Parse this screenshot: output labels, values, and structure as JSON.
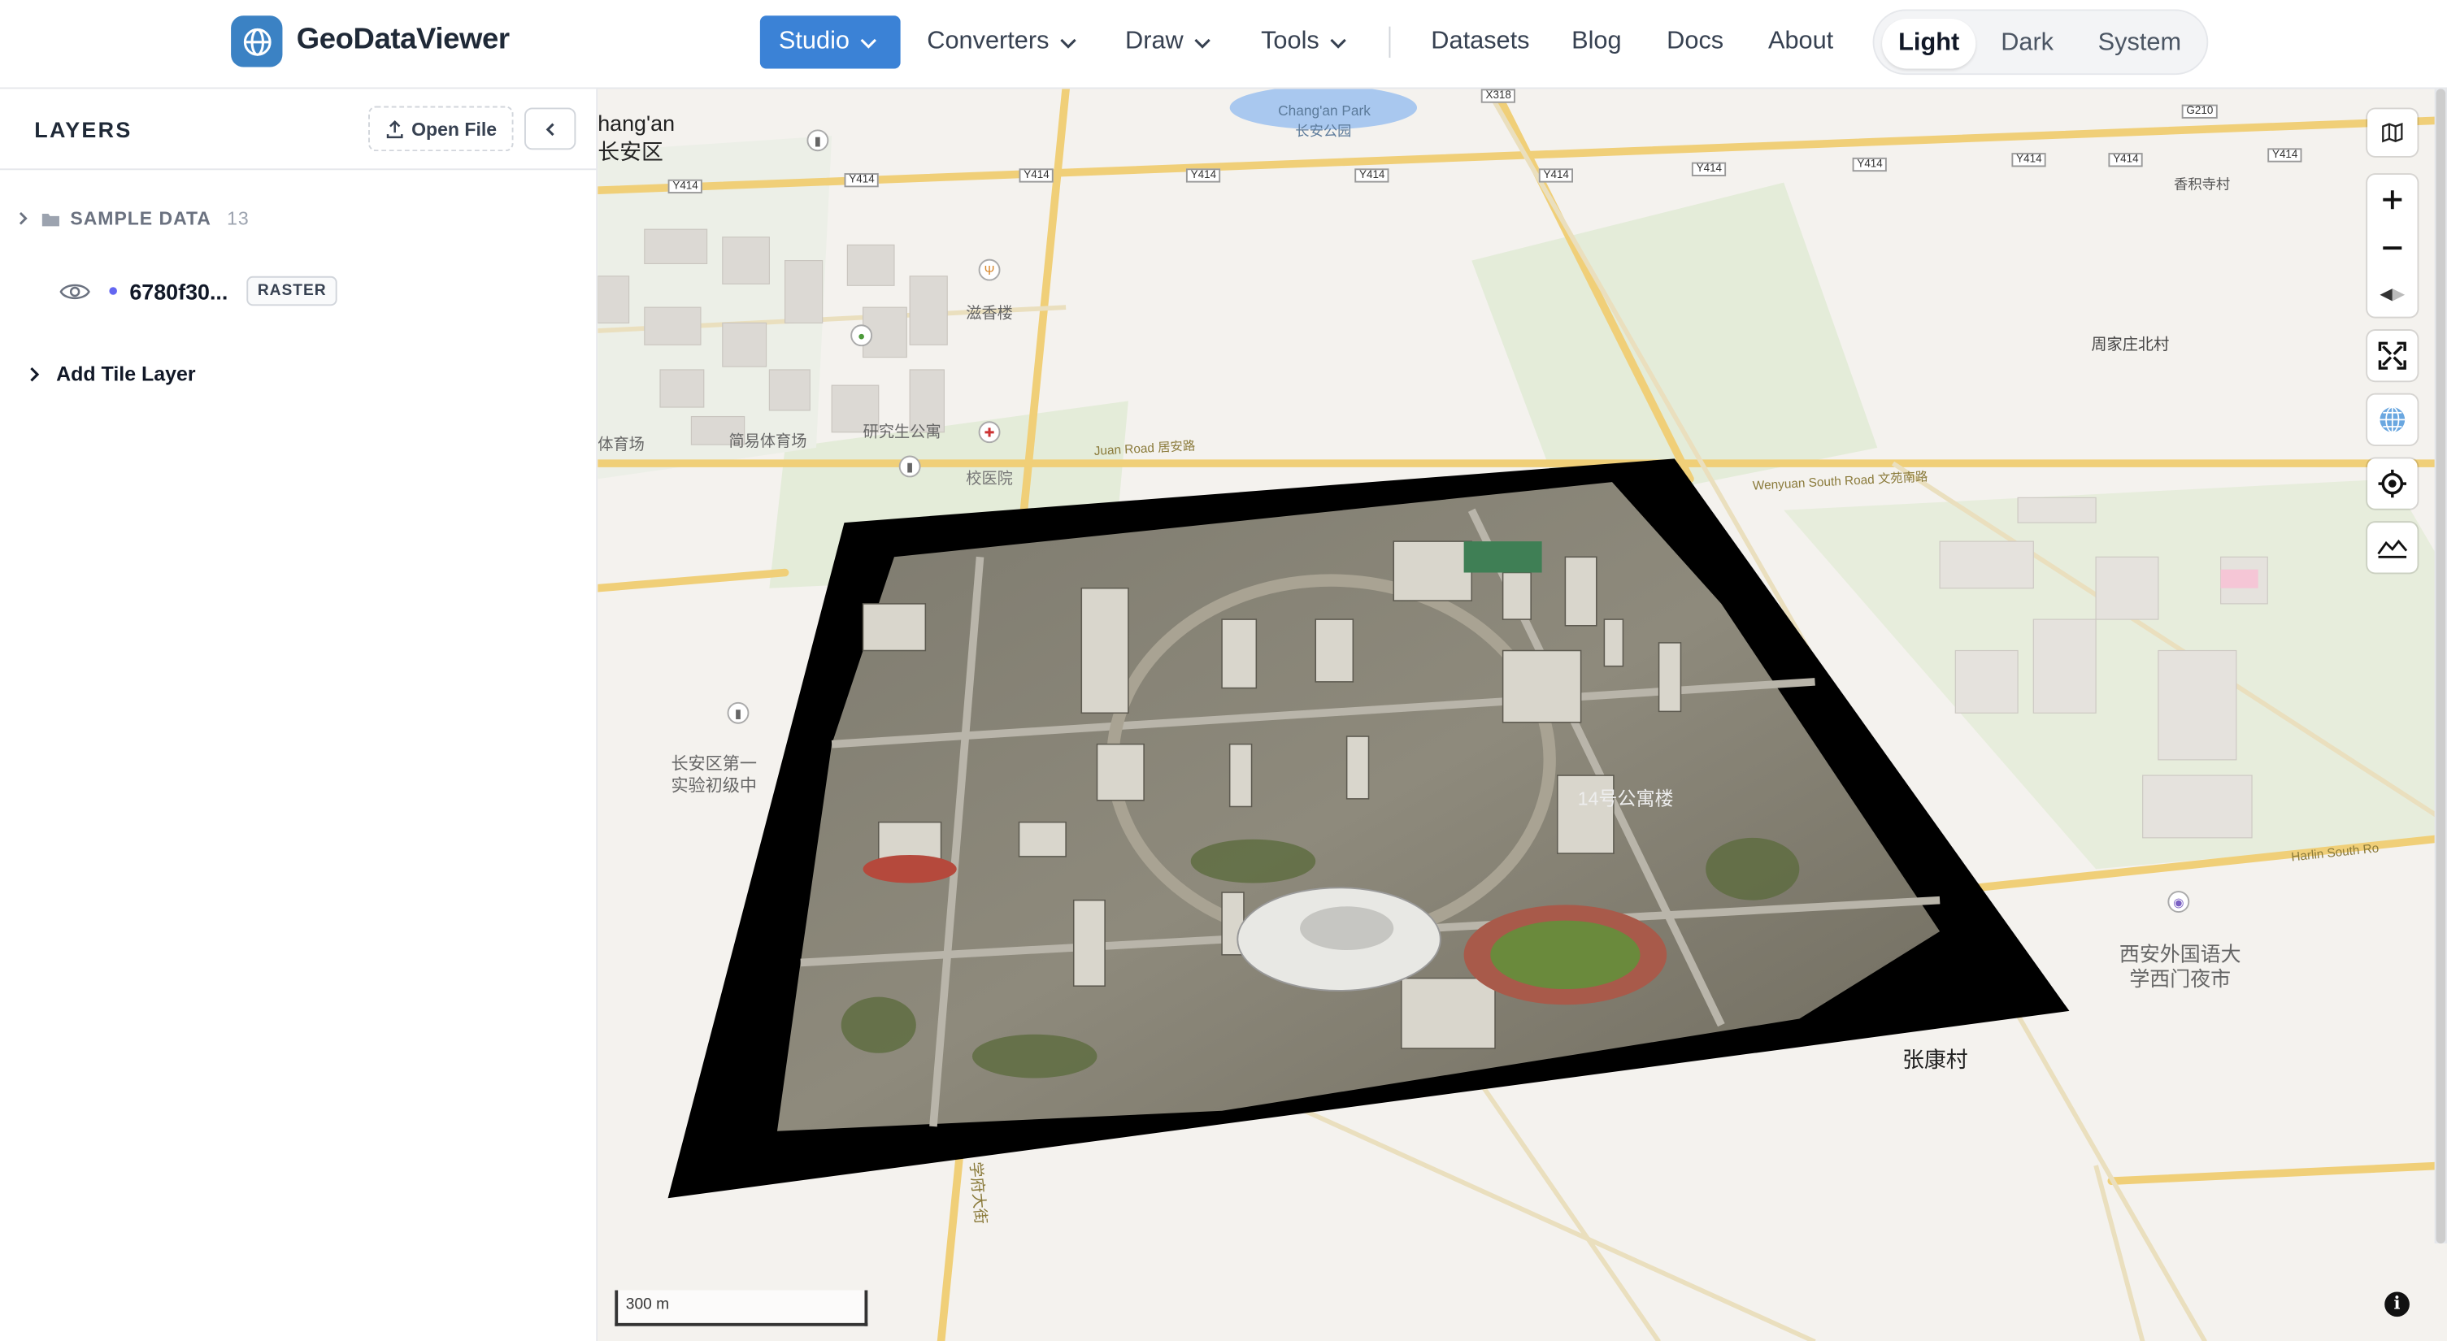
{
  "app": {
    "name": "GeoDataViewer"
  },
  "nav": {
    "studio": "Studio",
    "converters": "Converters",
    "draw": "Draw",
    "tools": "Tools",
    "datasets": "Datasets",
    "blog": "Blog",
    "docs": "Docs",
    "about": "About"
  },
  "theme": {
    "light": "Light",
    "dark": "Dark",
    "system": "System",
    "selected": "Light"
  },
  "sidebar": {
    "title": "LAYERS",
    "open_file": "Open File",
    "group": {
      "label": "SAMPLE DATA",
      "count": "13"
    },
    "layer": {
      "name": "6780f30...",
      "type": "RASTER"
    },
    "add_tile": "Add Tile Layer"
  },
  "map": {
    "labels": {
      "changan": "hang'an",
      "changan_cn": "长安区",
      "park_en": "Chang'an Park",
      "park_cn": "长安公园",
      "xiangji": "香积寺村",
      "zhoujia": "周家庄北村",
      "school": "长安区第一\n实验初级中",
      "hospital": "校医院",
      "gym": "简易体育场",
      "gym2": "体育场",
      "grad": "研究生公寓",
      "dining": "滋香楼",
      "zhangkang": "张康村",
      "market": "西安外国语大\n学西门夜市",
      "juan_road": "Juan Road 居安路",
      "wenyuan": "Wenyuan South Road 文苑南路",
      "harlin": "Harlin South Ro",
      "xuefu": "学府大街",
      "building14": "14号公寓楼"
    },
    "shields": [
      "Y414",
      "X318",
      "G210"
    ],
    "scale": "300 m",
    "colors": {
      "land": "#f4f2ee",
      "road": "#f2d27a",
      "green": "#dce9cf",
      "water": "#a9c8ef",
      "building": "#e3e0db"
    }
  }
}
